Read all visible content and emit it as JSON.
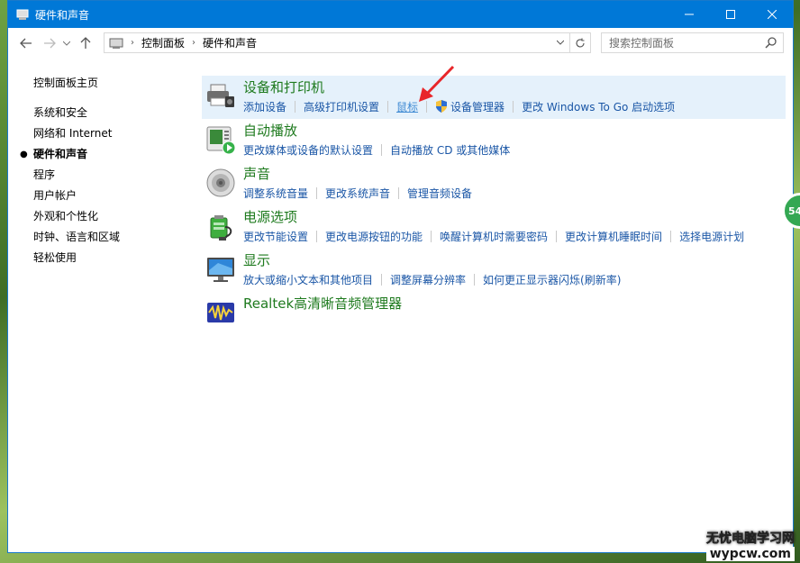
{
  "window": {
    "title": "硬件和声音"
  },
  "address": {
    "crumbs": [
      "控制面板",
      "硬件和声音"
    ]
  },
  "search": {
    "placeholder": "搜索控制面板"
  },
  "sidebar": {
    "home": "控制面板主页",
    "items": [
      {
        "label": "系统和安全",
        "current": false
      },
      {
        "label": "网络和 Internet",
        "current": false
      },
      {
        "label": "硬件和声音",
        "current": true
      },
      {
        "label": "程序",
        "current": false
      },
      {
        "label": "用户帐户",
        "current": false
      },
      {
        "label": "外观和个性化",
        "current": false
      },
      {
        "label": "时钟、语言和区域",
        "current": false
      },
      {
        "label": "轻松使用",
        "current": false
      }
    ]
  },
  "categories": [
    {
      "title": "设备和打印机",
      "icon": "printer-icon",
      "links": [
        "添加设备",
        "高级打印机设置",
        "鼠标",
        "设备管理器",
        "更改 Windows To Go 启动选项"
      ]
    },
    {
      "title": "自动播放",
      "icon": "autoplay-icon",
      "links": [
        "更改媒体或设备的默认设置",
        "自动播放 CD 或其他媒体"
      ]
    },
    {
      "title": "声音",
      "icon": "speaker-icon",
      "links": [
        "调整系统音量",
        "更改系统声音",
        "管理音频设备"
      ]
    },
    {
      "title": "电源选项",
      "icon": "power-options-icon",
      "links": [
        "更改节能设置",
        "更改电源按钮的功能",
        "唤醒计算机时需要密码",
        "更改计算机睡眠时间",
        "选择电源计划"
      ]
    },
    {
      "title": "显示",
      "icon": "display-icon",
      "links": [
        "放大或缩小文本和其他项目",
        "调整屏幕分辨率",
        "如何更正显示器闪烁(刷新率)"
      ]
    },
    {
      "title": "Realtek高清晰音频管理器",
      "icon": "realtek-audio-icon",
      "links": []
    }
  ],
  "badge": {
    "text": "54"
  },
  "watermark": {
    "line1": "无忧电脑学习网",
    "line2": "wypcw.com"
  },
  "colors": {
    "titlebar": "#0078d7",
    "category_title": "#1e7a1e",
    "link": "#1a56a6",
    "highlight": "#e5f1fb",
    "arrow": "#e8262a"
  }
}
